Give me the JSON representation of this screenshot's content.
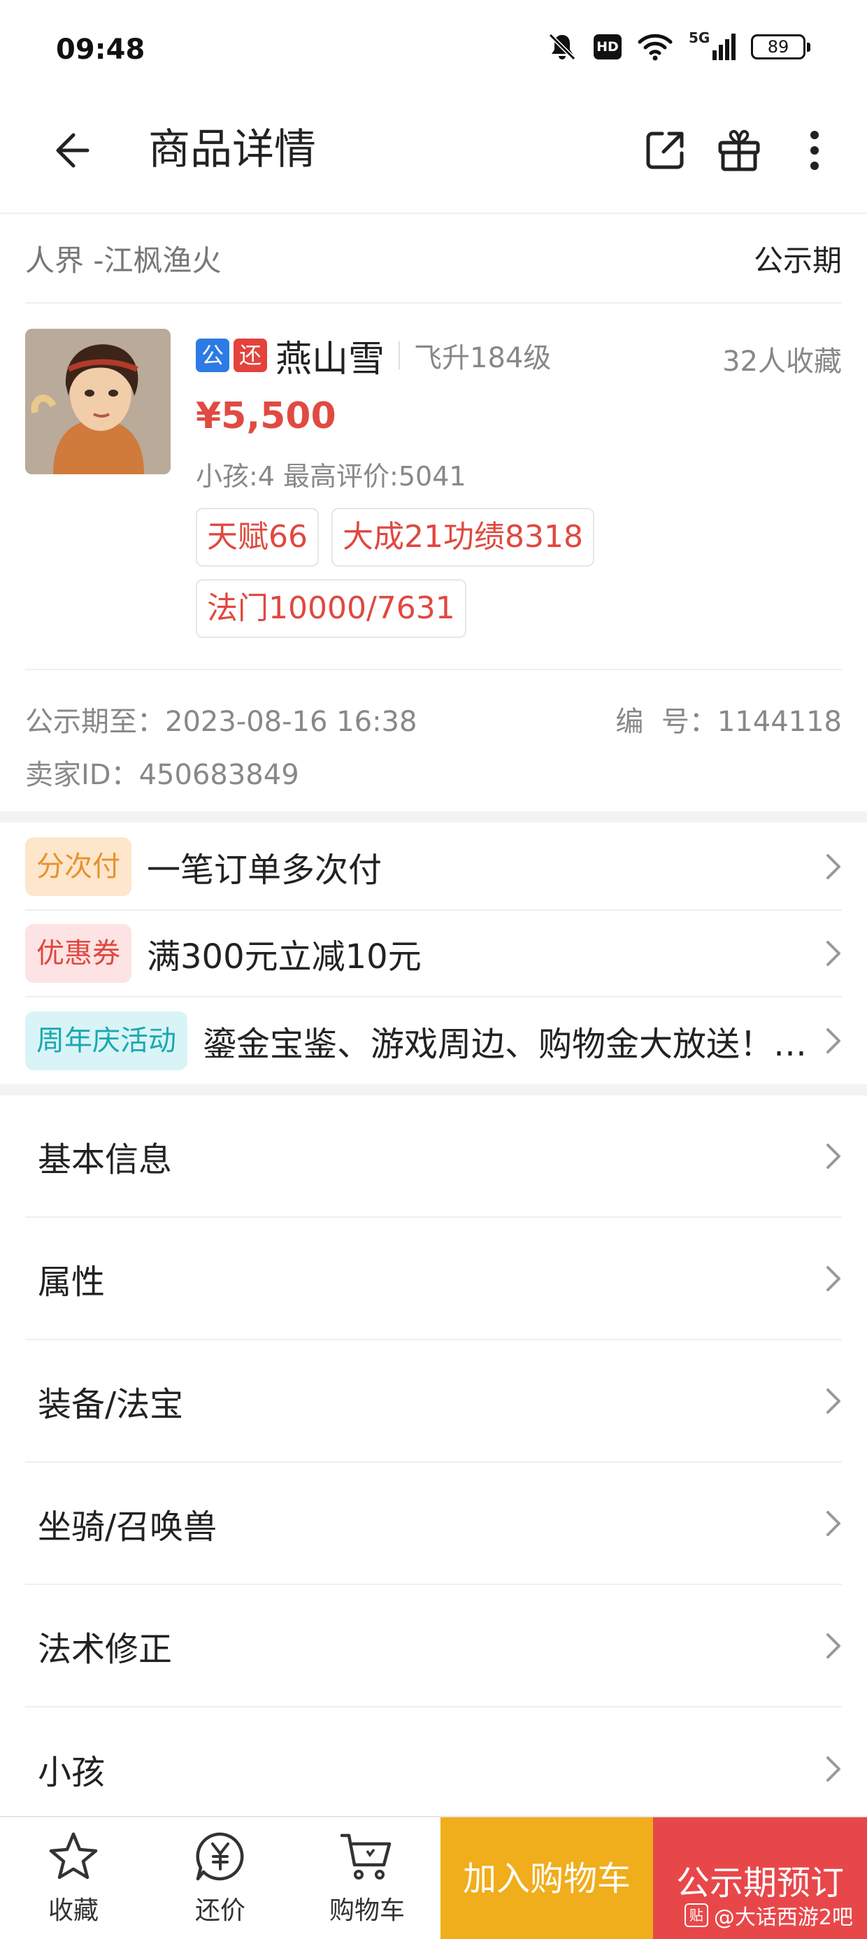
{
  "status_bar": {
    "time": "09:48",
    "network": "5G",
    "hd": "HD",
    "battery": "89"
  },
  "header": {
    "title": "商品详情",
    "icons": [
      "share-icon",
      "gift-icon",
      "more-icon"
    ]
  },
  "server": {
    "name": "人界 -江枫渔火",
    "period": "公示期"
  },
  "product": {
    "tag_public": "公",
    "tag_bargain": "还",
    "name": "燕山雪",
    "level": "飞升184级",
    "favorites": "32人收藏",
    "price": "¥5,500",
    "stats": "小孩:4 最高评价:5041",
    "chips": [
      "天赋66",
      "大成21功绩8318",
      "法门10000/7631"
    ]
  },
  "meta": {
    "period_end_label": "公示期至：",
    "period_end_value": "2023-08-16 16:38",
    "id_label": "编  号：",
    "id_value": "1144118",
    "seller_label": "卖家ID：",
    "seller_value": "450683849"
  },
  "promos": [
    {
      "tag": "分次付",
      "text": "一笔订单多次付",
      "tag_bg": "#fde6cc",
      "tag_color": "#e7922e"
    },
    {
      "tag": "优惠券",
      "text": "满300元立减10元",
      "tag_bg": "#fde3e3",
      "tag_color": "#e0483f"
    },
    {
      "tag": "周年庆活动",
      "text": "鎏金宝鉴、游戏周边、购物金大放送！…",
      "tag_bg": "#d9f4f6",
      "tag_color": "#1aa8b3"
    }
  ],
  "menu": [
    {
      "label": "基本信息"
    },
    {
      "label": "属性"
    },
    {
      "label": "装备/法宝"
    },
    {
      "label": "坐骑/召唤兽"
    },
    {
      "label": "法术修正"
    },
    {
      "label": "小孩"
    }
  ],
  "bottom_bar": {
    "tabs": [
      {
        "label": "收藏",
        "icon": "star-icon"
      },
      {
        "label": "还价",
        "icon": "yen-chat-icon"
      },
      {
        "label": "购物车",
        "icon": "cart-icon"
      }
    ],
    "add_cart": "加入购物车",
    "reserve": "公示期预订",
    "watermark": "@大话西游2吧",
    "watermark_logo": "贴"
  },
  "colors": {
    "price": "#e04a42",
    "cart_button": "#f0ad1c",
    "reserve_button": "#e8474a",
    "tag_public": "#2d7be5",
    "tag_bargain": "#e4423d"
  }
}
